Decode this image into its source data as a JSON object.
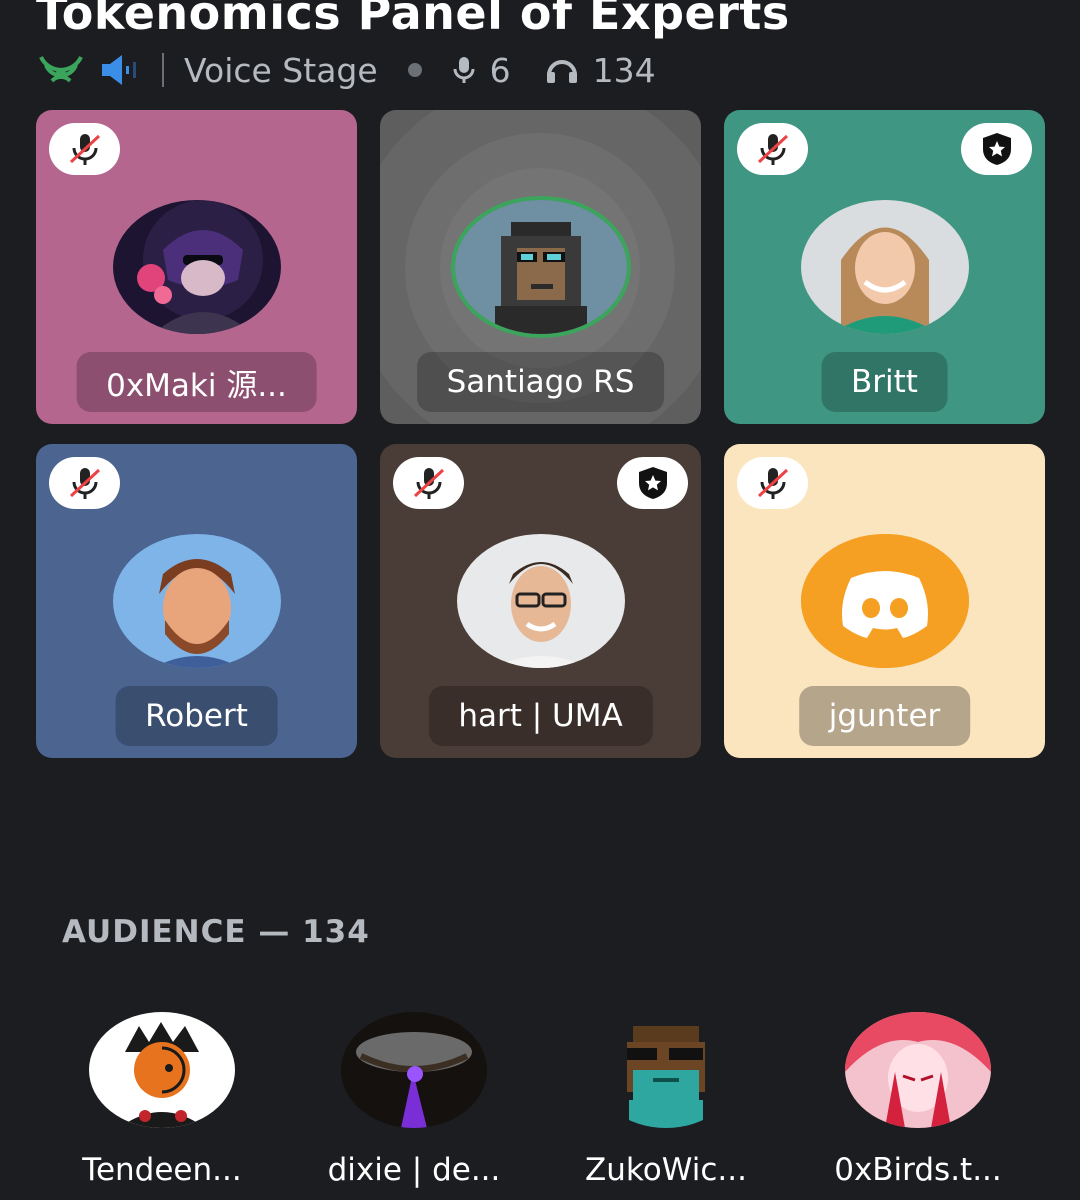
{
  "stage": {
    "title": "Tokenomics Panel of Experts",
    "type_label": "Voice Stage",
    "speaker_count": "6",
    "listener_count": "134"
  },
  "speakers": [
    {
      "name": "0xMaki 源...",
      "bg": "#b5668f",
      "moderator": false
    },
    {
      "name": "Santiago RS",
      "bg": "#5e5e5e",
      "moderator": false,
      "speaking": true
    },
    {
      "name": "Britt",
      "bg": "#3f9683",
      "moderator": true
    },
    {
      "name": "Robert",
      "bg": "#4b6490",
      "moderator": false
    },
    {
      "name": "hart | UMA",
      "bg": "#4a3c36",
      "moderator": true
    },
    {
      "name": "jgunter",
      "bg": "#fbe5bf",
      "moderator": false
    }
  ],
  "audience": {
    "label": "AUDIENCE — 134",
    "members": [
      {
        "name": "Tendeen..."
      },
      {
        "name": "dixie | de..."
      },
      {
        "name": "ZukoWic..."
      },
      {
        "name": "0xBirds.t..."
      }
    ]
  },
  "colors": {
    "background": "#1c1d20",
    "connected_green": "#3ba55c",
    "speaking_ring": "#3ba55c",
    "discord_orange": "#f6a023"
  },
  "icons": {
    "connection": "signal-broadcast-icon",
    "volume": "speaker-volume-icon",
    "speakers": "microphone-icon",
    "listeners": "headphones-icon",
    "muted": "muted-mic-icon",
    "moderator": "shield-star-icon"
  }
}
